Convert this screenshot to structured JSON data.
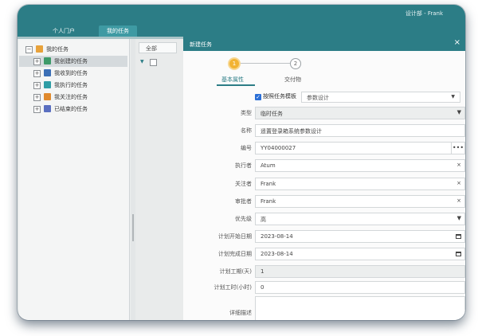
{
  "header": {
    "user": "设计部 - Frank"
  },
  "tabs": [
    {
      "label": "个人门户"
    },
    {
      "label": "我的任务"
    }
  ],
  "tree": {
    "root": "我的任务",
    "children": [
      "我创建的任务",
      "我收到的任务",
      "我执行的任务",
      "我关注的任务",
      "已结束的任务"
    ]
  },
  "middle": {
    "filter": "全部"
  },
  "modal": {
    "title": "新建任务",
    "steps": [
      {
        "num": "1",
        "label": "基本属性"
      },
      {
        "num": "2",
        "label": "交付物"
      }
    ],
    "template": {
      "label": "按照任务模板",
      "value": "参数设计",
      "checked": true
    },
    "fields": {
      "type": {
        "label": "类型",
        "value": "临时任务"
      },
      "name": {
        "label": "名称",
        "value": "遥置登录箱系统参数设计"
      },
      "code": {
        "label": "编号",
        "value": "YY04000027"
      },
      "executor": {
        "label": "执行者",
        "value": "Atum"
      },
      "follower": {
        "label": "关注者",
        "value": "Frank"
      },
      "approver": {
        "label": "审批者",
        "value": "Frank"
      },
      "priority": {
        "label": "优先级",
        "value": "高"
      },
      "start": {
        "label": "计划开始日期",
        "value": "2023-08-14"
      },
      "end": {
        "label": "计划完成日期",
        "value": "2023-08-14"
      },
      "workdays": {
        "label": "计划工期(天)",
        "value": "1"
      },
      "workhours": {
        "label": "计划工时(小时)",
        "value": "0"
      },
      "desc": {
        "label": "详细描述",
        "value": ""
      }
    }
  },
  "icons": {
    "close": "×",
    "clear": "×",
    "dropdown": "▼",
    "more": "•••"
  },
  "colors": {
    "teal": "#2c7d86",
    "step_active": "#f2b333",
    "checkbox": "#2b6fd6"
  }
}
